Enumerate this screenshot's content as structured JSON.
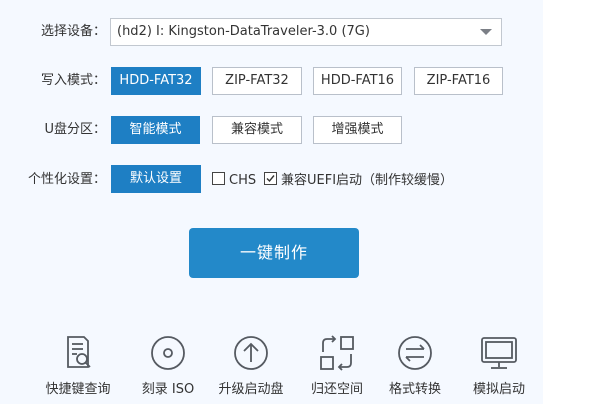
{
  "device": {
    "label": "选择设备：",
    "value": "(hd2) I:  Kingston-DataTraveler-3.0 (7G)"
  },
  "write_mode": {
    "label": "写入模式：",
    "options": [
      "HDD-FAT32",
      "ZIP-FAT32",
      "HDD-FAT16",
      "ZIP-FAT16"
    ],
    "selected": "HDD-FAT32"
  },
  "partition": {
    "label": "U盘分区：",
    "options": [
      "智能模式",
      "兼容模式",
      "增强模式"
    ],
    "selected": "智能模式"
  },
  "personalize": {
    "label": "个性化设置：",
    "button": "默认设置",
    "chs_label": "CHS",
    "chs_checked": false,
    "uefi_label": "兼容UEFI启动（制作较缓慢）",
    "uefi_checked": true
  },
  "make_button": "一键制作",
  "tools": [
    {
      "label": "快捷键查询",
      "icon": "hotkey-search-icon"
    },
    {
      "label": "刻录 ISO",
      "icon": "disc-icon"
    },
    {
      "label": "升级启动盘",
      "icon": "upgrade-icon"
    },
    {
      "label": "归还空间",
      "icon": "restore-space-icon"
    },
    {
      "label": "格式转换",
      "icon": "convert-icon"
    },
    {
      "label": "模拟启动",
      "icon": "monitor-icon"
    }
  ],
  "colors": {
    "accent": "#1e7fc4",
    "panel_bg": "#f5f9ff",
    "icon_stroke": "#555a61"
  }
}
